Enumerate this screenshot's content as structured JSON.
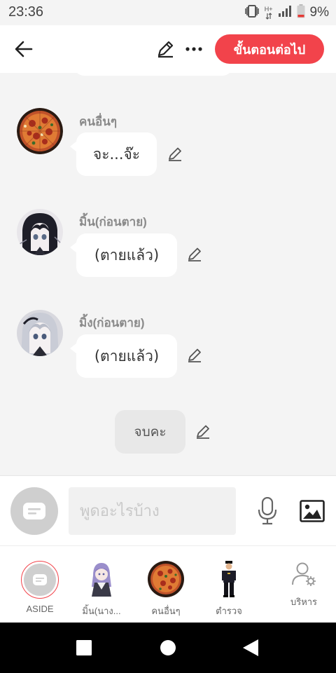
{
  "status_bar": {
    "time": "23:36",
    "battery": "9%",
    "network": "H+"
  },
  "top_bar": {
    "next_button_label": "ขั้นตอนต่อไป"
  },
  "messages": [
    {
      "sender": "คนอื่นๆ",
      "text": "จะ...จ๊ะ",
      "avatar": "pizza-avatar"
    },
    {
      "sender": "มิ้น(ก่อนตาย)",
      "text": "(ตายแล้ว)",
      "avatar": "anime-girl-dark-avatar"
    },
    {
      "sender": "มิ้ง(ก่อนตาย)",
      "text": "(ตายแล้ว)",
      "avatar": "anime-girl-silver-avatar"
    }
  ],
  "narration": {
    "text": "จบคะ"
  },
  "input": {
    "placeholder": "พูดอะไรบ้าง"
  },
  "characters": [
    {
      "label": "ASIDE",
      "icon": "aside-icon",
      "selected": true
    },
    {
      "label": "มิ้น(นาง...",
      "icon": "anime-character-icon"
    },
    {
      "label": "คนอื่นๆ",
      "icon": "pizza-icon"
    },
    {
      "label": "ตำรวจ",
      "icon": "police-figure-icon"
    },
    {
      "label": "บริหาร",
      "icon": "manage-user-icon"
    }
  ],
  "colors": {
    "accent": "#f2434b",
    "background": "#f4f4f4",
    "bubble": "#ffffff"
  }
}
